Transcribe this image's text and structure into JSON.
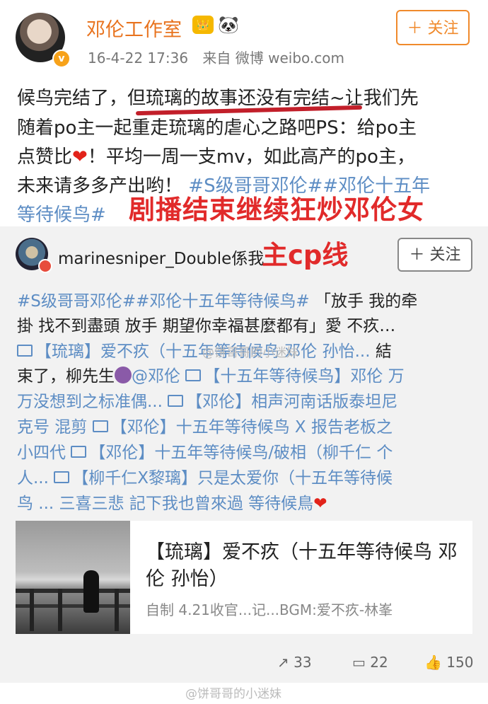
{
  "post": {
    "author": "邓伦工作室",
    "vip_badge": "👑",
    "panda_icon": "🐼",
    "time": "16-4-22 17:36",
    "source": "来自 微博 weibo.com",
    "follow": "＋ 关注",
    "lines": [
      "候鸟完结了，但琉璃的故事还没有完结~让我们先",
      "随着po主一起重走琉璃的虐心之路吧PS：给po主",
      "点赞比",
      "！平均一周一支mv，如此高产的po主，",
      "未来请多多产出哟！",
      "#S级哥哥邓伦##邓伦十五年",
      "等待候鸟#"
    ],
    "heart": "❤"
  },
  "overlay": {
    "line1": "剧播结束继续狂炒邓伦女",
    "line2": "主cp线"
  },
  "repost": {
    "username": "marinesniper_Double係我",
    "follow": "＋ 关注",
    "l1a": "#S级哥哥邓伦##邓伦十五年等待候鸟#",
    "l1b": "「放手 我的牵",
    "l2": "掛 找不到盡頭 放手 期望你幸福甚麼都有」愛 不疚…",
    "l3a": "【琉璃】爱不疚（十五年等待候鸟 邓伦 孙怡...",
    "l3b": "結",
    "l4a": "束了，柳先生",
    "l4b": "@邓伦",
    "l4c": "【十五年等待候鸟】邓伦 万",
    "l5a": "万没想到之标准偶...",
    "l5b": "【邓伦】相声河南话版泰坦尼",
    "l6a": "克号 混剪",
    "l6b": "【邓伦】十五年等待候鸟 X 报告老板之",
    "l7a": "小四代",
    "l7b": "【邓伦】十五年等待候鸟/破相（柳千仁 个",
    "l8a": "人...",
    "l8b": "【柳千仁X黎璃】只是太爱你（十五年等待候",
    "l9": "鸟 ...  三喜三悲 記下我也曾來過 等待候鳥",
    "heart": "❤"
  },
  "card": {
    "title": "【琉璃】爱不疚（十五年等待候鸟 邓伦 孙怡）",
    "subtitle": "自制 4.21收官...记...BGM:爱不疚-林峯"
  },
  "actions": {
    "repost_count": "33",
    "comment_count": "22",
    "like_count": "150"
  },
  "watermark": {
    "text": "@饼哥哥的小迷妹"
  }
}
